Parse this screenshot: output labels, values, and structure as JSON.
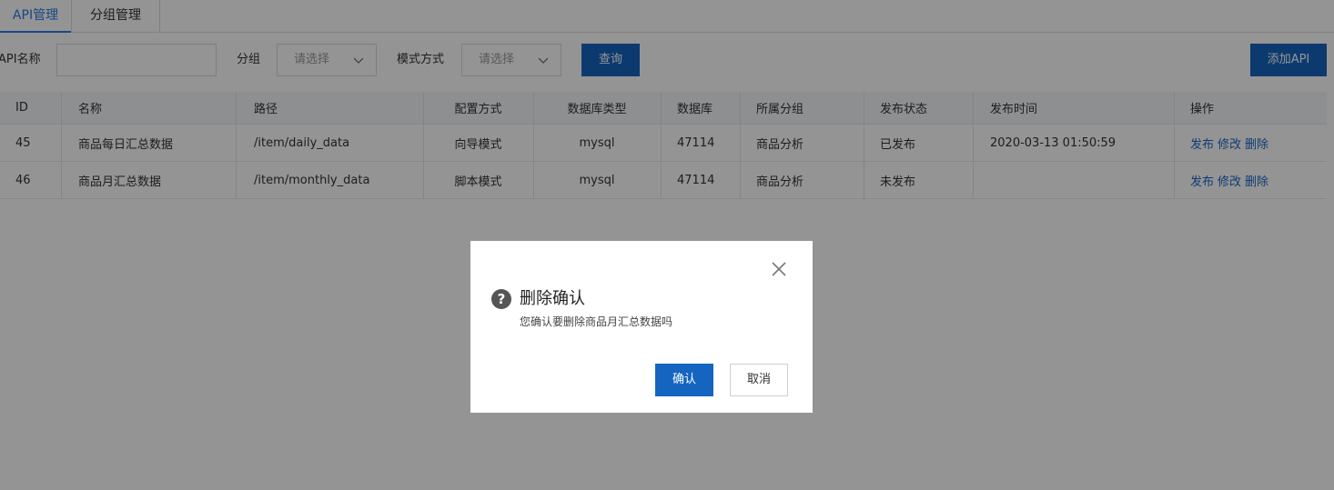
{
  "tabs": [
    {
      "label": "API管理",
      "active": true
    },
    {
      "label": "分组管理",
      "active": false
    }
  ],
  "filter": {
    "api_name_label": "API名称",
    "api_name_value": "",
    "group_label": "分组",
    "group_placeholder": "请选择",
    "mode_label": "模式方式",
    "mode_placeholder": "请选择",
    "query_button": "查询",
    "add_button": "添加API"
  },
  "table": {
    "headers": [
      "ID",
      "名称",
      "路径",
      "配置方式",
      "数据库类型",
      "数据库",
      "所属分组",
      "发布状态",
      "发布时间",
      "操作"
    ],
    "rows": [
      {
        "id": "45",
        "name": "商品每日汇总数据",
        "path": "/item/daily_data",
        "config_mode": "向导模式",
        "db_type": "mysql",
        "db": "47114",
        "group": "商品分析",
        "status": "已发布",
        "time": "2020-03-13 01:50:59",
        "ops": [
          "发布",
          "修改",
          "删除"
        ]
      },
      {
        "id": "46",
        "name": "商品月汇总数据",
        "path": "/item/monthly_data",
        "config_mode": "脚本模式",
        "db_type": "mysql",
        "db": "47114",
        "group": "商品分析",
        "status": "未发布",
        "time": "",
        "ops": [
          "发布",
          "修改",
          "删除"
        ]
      }
    ]
  },
  "dialog": {
    "title": "删除确认",
    "message": "您确认要删除商品月汇总数据吗",
    "confirm_button": "确认",
    "cancel_button": "取消"
  },
  "colors": {
    "primary": "#1565c0",
    "tab_active": "#2a7ae2",
    "link": "#1a66c8"
  }
}
